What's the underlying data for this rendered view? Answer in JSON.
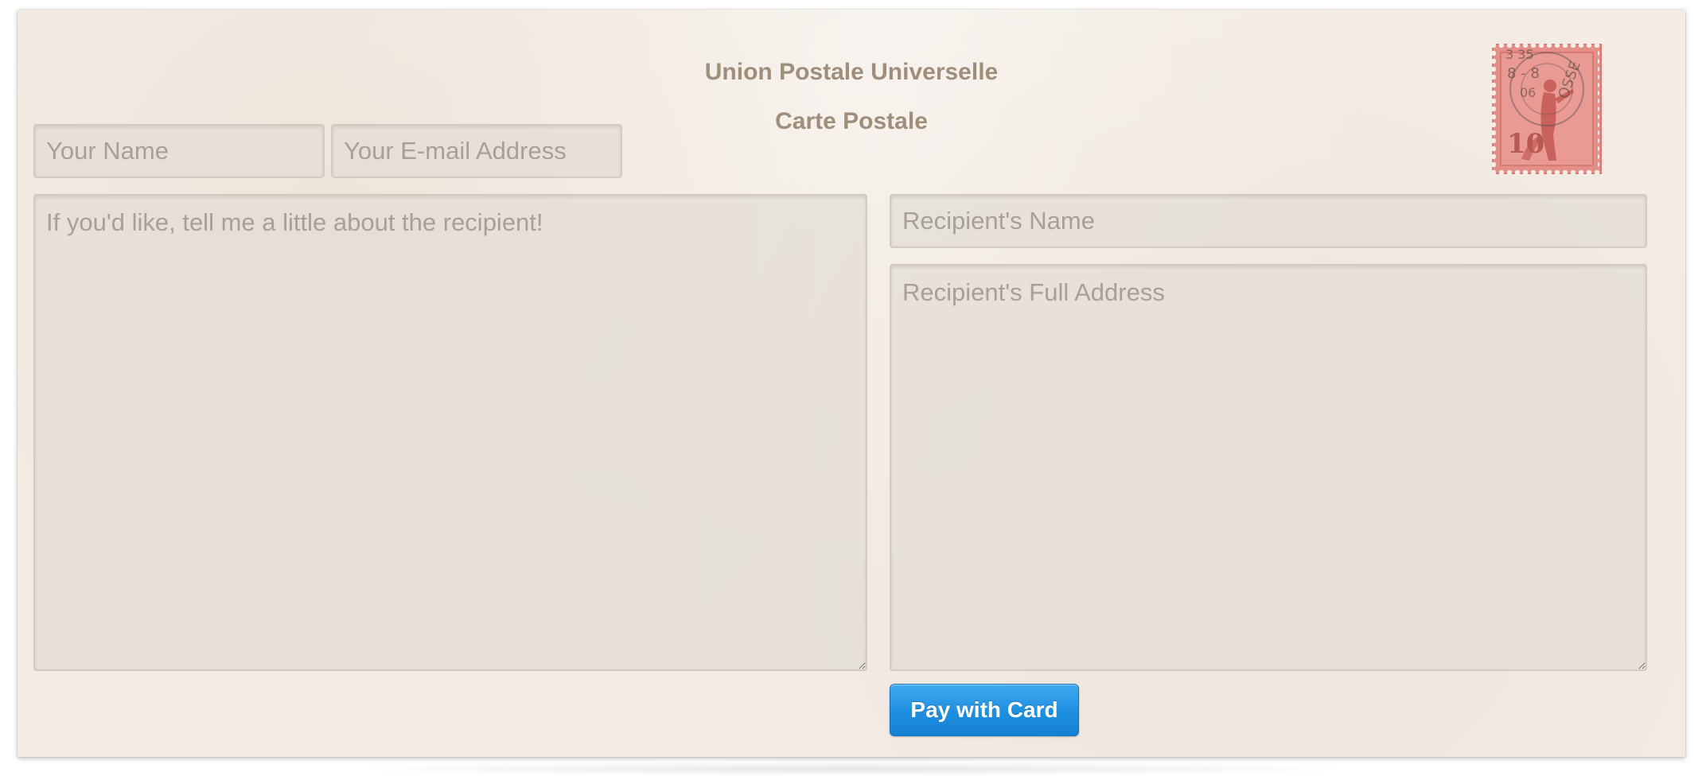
{
  "header": {
    "title": "Union Postale Universelle",
    "subtitle": "Carte Postale"
  },
  "form": {
    "your_name_placeholder": "Your Name",
    "your_email_placeholder": "Your E-mail Address",
    "about_placeholder": "If you'd like, tell me a little about the recipient!",
    "recipient_name_placeholder": "Recipient's Name",
    "recipient_address_placeholder": "Recipient's Full Address",
    "pay_button_label": "Pay with Card"
  },
  "stamp": {
    "icon": "postage-stamp-icon",
    "color": "#e08b84"
  },
  "colors": {
    "paper": "#f3ede6",
    "heading": "#a08e7b",
    "button": "#1e8fe0"
  }
}
